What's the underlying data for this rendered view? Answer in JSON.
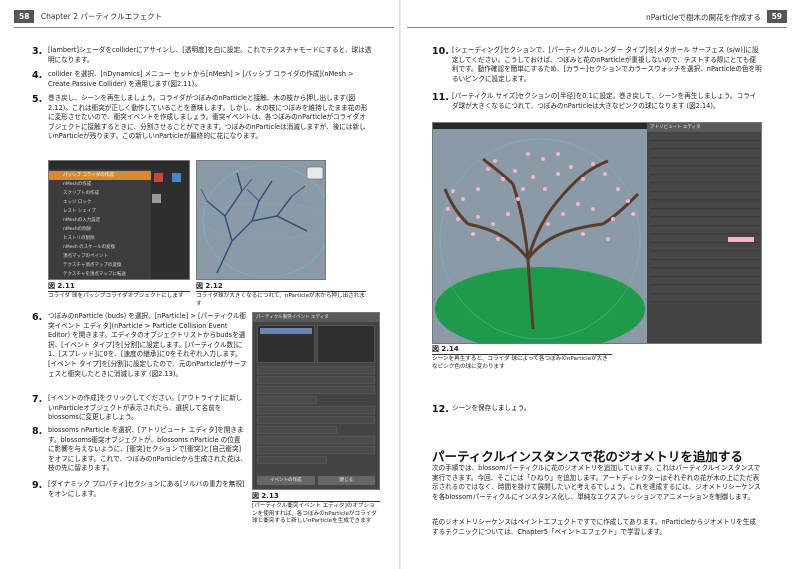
{
  "left_page": {
    "page_number": "58",
    "chapter_header": "Chapter 2  パーティクルエフェクト",
    "steps": [
      {
        "num": "3.",
        "text": "[lambert]シェーダをcolliderにアサインし、[透明度]を白に設定。これでテクスチャモードにすると、球は透明になります。"
      },
      {
        "num": "4.",
        "text": "collider を選択、[nDynamics] メニュー セットから[nMesh] > [パッシブ コライダの作成](nMesh > Create Passive Collider) を適用します(図2.11)。"
      },
      {
        "num": "5.",
        "text": "巻き戻し、シーンを再生しましょう。コライダがつぼみのnParticleと接触、木の枝から押し出します(図2.12)。これは衝突が正しく動作していることを意味します。しかし、木の枝につぼみを維持したまま花の形に変形させたいので、衝突イベントを作成しましょう。衝突イベントは、各つぼみのnParticleがコライダオブジェクトに接触するときに、分割させることができます。つぼみのnParticleは消滅しますが、後には新しいnParticleが残ります。この新しいnParticleが最終的に花になります。"
      },
      {
        "num": "6.",
        "text": "つぼみのnParticle (buds) を選択、[nParticle] > [パーティクル衝突イベント エディタ](nParticle > Particle Collision Event Editor) を開きます。エディタのオブジェクトリストからbudsを選択、[イベント タイプ]を[分割]に設定します。[パーティクル数]に1、[スプレッド]に0を、[速度の継承]に0をそれぞれ入力します。[イベント タイプ]を[分割]に設定したので、元のnParticleがサーフェスと衝突したときに消滅します (図2.13)。"
      },
      {
        "num": "7.",
        "text": "[イベントの作成]をクリックしてください。[アウトライナ]に新しいnParticleオブジェクトが表示されたら、選択して名前をblossomsに変更しましょう。"
      },
      {
        "num": "8.",
        "text": "blossoms nParticle を選択、[アトリビュート エディタ]を開きます。blossoms衝突オブジェクトが、blossoms nParticle の位置に影響を与えないように、[衝突]セクションで[衝突]と[自己衝突]をオフにします。これで、つぼみのnParticleから生成された花は、枝の先に留まります。"
      },
      {
        "num": "9.",
        "text": "[ダイナミック プロパティ]セクションにある[ソルバの重力を無視]をオンにします。"
      }
    ],
    "figures": [
      {
        "label": "図 2.11",
        "caption": "コライダ 球をパッシブコライダオブジェクトにします"
      },
      {
        "label": "図 2.12",
        "caption": "コライダ球が大きくなるにつれて、nParticleが木から押し出されます"
      },
      {
        "label": "図 2.13",
        "caption": "[パーティクル衝突イベント エディタ]のオプションを使用すれば、各つぼみのnParticleがコライダ球と衝突すると新しいnParticleを生成できます"
      }
    ],
    "maya_menu": {
      "title": "パッシブ コライダの作成",
      "items": [
        "nMeshの作成",
        "スクリプトの作成",
        "エッジ ロック",
        "レスト シェイプ",
        "nMeshの入力設定",
        "nMeshの削除",
        "ヒストリの削除",
        "nMesh のスケールの変換",
        "頂点マップのペイント",
        "テクスチャ頂点マップの変換",
        "テクスチャを頂点マップに転送",
        "頂点をテクスチャ マップに変換"
      ]
    },
    "event_editor": {
      "title": "パーティクル衝突イベント エディタ",
      "create_button": "イベントの作成",
      "close_button": "閉じる"
    }
  },
  "right_page": {
    "page_number": "59",
    "header_title": "nParticleで樹木の開花を作成する",
    "steps": [
      {
        "num": "10.",
        "text": "[シェーディング]セクションで、[パーティクルのレンダー タイプ]を[メタボール サーフェス (s/w)]に設定してください。こうしておけば、つぼみと花のnParticleが重複しないので、テストする際にとても便利です。動作確認を簡単にするため、[カラー]セクションでカラースウォッチを選択、nParticleの色を明るいピンクに設定します。"
      },
      {
        "num": "11.",
        "text": "[パーティクル サイズ]セクションの[半径]を0.1に設定。巻き戻して、シーンを再生しましょう。コライダ球が大きくなるにつれて、つぼみのnParticleは大きなピンクの球になります (図2.14)。"
      },
      {
        "num": "12.",
        "text": "シーンを保存しましょう。"
      }
    ],
    "figure": {
      "label": "図 2.14",
      "caption": "シーンを再生すると、コライダ 球によって各つぼみのnParticleが大きなピンク色の球に変わります"
    },
    "attribute_editor_title": "アトリビュート エディタ",
    "section_title": "パーティクルインスタンスで花のジオメトリを追加する",
    "paragraphs": [
      "次の手順では、blossomパーティクルに花のジオメトリを追加しています。これはパーティクルインスタンスで実行できます。今回、そこには「ひねり」を追加します。アートディレクターはそれぞれの花が木の上にただ表示されるのではなく、時間を掛けて展開したいと考えるでしょう。これを達成するには、ジオメトリシーケンスを各blossomパーティクルにインスタンス化し、単純なエクスプレッションでアニメーションを制御します。",
      "花のジオメトリシーケンスはペイントエフェクトですでに作成してあります。nParticleからジオメトリを生成するテクニックについては、Chapter5「ペイントエフェクト」で学習します。"
    ]
  },
  "colors": {
    "header_badge": "#555555",
    "maya_panel": "#3c3c3c",
    "menu_highlight": "#d98a2a",
    "viewport_bg": "#8a9aa6",
    "ground": "#1f9a4a",
    "blossom_pink": "#f2b6c8",
    "branch": "#5a3a2a"
  }
}
